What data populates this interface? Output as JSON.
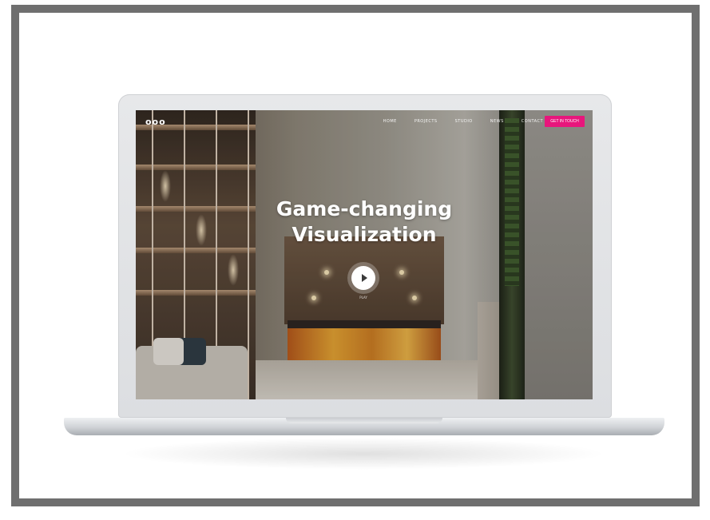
{
  "site": {
    "logo": "ooo",
    "nav": [
      "HOME",
      "PROJECTS",
      "STUDIO",
      "NEWS",
      "CONTACT"
    ],
    "cta_label": "GET IN TOUCH",
    "hero_title_line1": "Game-changing",
    "hero_title_line2": "Visualization",
    "play_caption": "PLAY"
  },
  "colors": {
    "frame_border": "#6f6f6f",
    "cta_background": "#e8167c",
    "hero_text": "#ffffff",
    "laptop_body": "#dcdee1"
  },
  "icons": {
    "play": "play-icon"
  }
}
